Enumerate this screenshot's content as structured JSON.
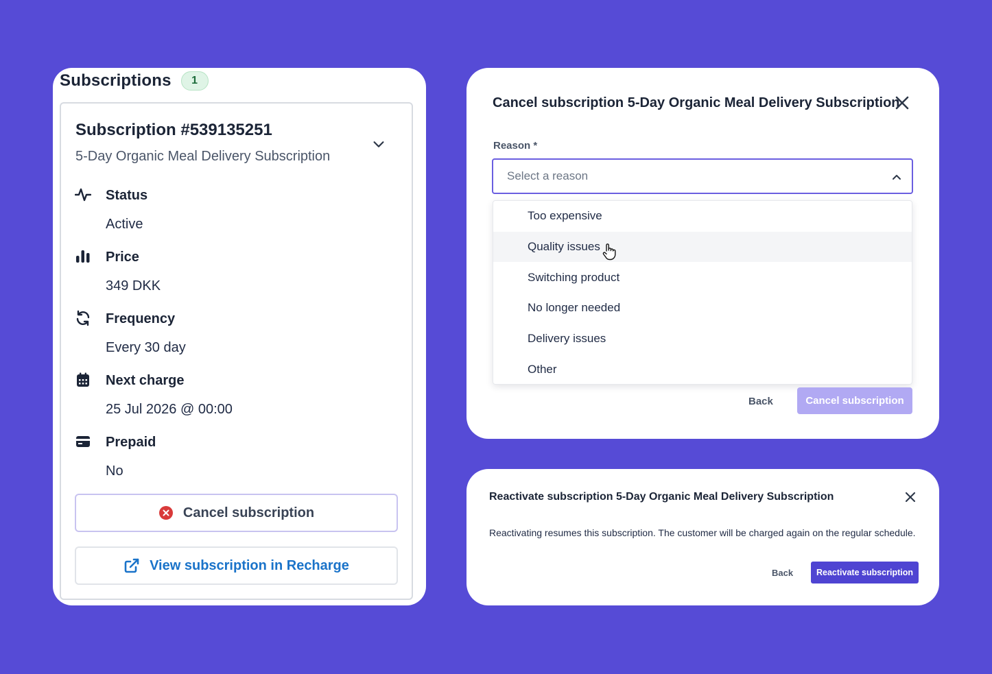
{
  "subscriptions": {
    "title": "Subscriptions",
    "count": "1",
    "card": {
      "id": "Subscription #539135251",
      "product": "5-Day Organic Meal Delivery Subscription",
      "details": [
        {
          "label": "Status",
          "value": "Active",
          "icon": "activity-icon"
        },
        {
          "label": "Price",
          "value": "349 DKK",
          "icon": "bar-chart-icon"
        },
        {
          "label": "Frequency",
          "value": "Every 30 day",
          "icon": "refresh-icon"
        },
        {
          "label": "Next charge",
          "value": "25 Jul 2026 @ 00:00",
          "icon": "calendar-icon"
        },
        {
          "label": "Prepaid",
          "value": "No",
          "icon": "credit-card-icon"
        }
      ],
      "cancel_label": "Cancel subscription",
      "view_label": "View subscription in Recharge"
    }
  },
  "cancel_modal": {
    "title": "Cancel subscription 5-Day Organic Meal Delivery Subscription",
    "reason_label": "Reason *",
    "select_placeholder": "Select a reason",
    "options": [
      "Too expensive",
      "Quality issues",
      "Switching product",
      "No longer needed",
      "Delivery issues",
      "Other"
    ],
    "hovered_option": "Quality issues",
    "back_label": "Back",
    "submit_label": "Cancel subscription"
  },
  "reactivate_modal": {
    "title": "Reactivate subscription 5-Day Organic Meal Delivery Subscription",
    "message": "Reactivating resumes this subscription. The customer will be charged again on the regular schedule.",
    "back_label": "Back",
    "submit_label": "Reactivate subscription"
  },
  "colors": {
    "background": "#564bd6",
    "accent": "#4f44d2",
    "accent_disabled": "#b1a9f3",
    "link": "#1a73c9",
    "danger": "#d93a3a",
    "badge_bg": "#dff4e6"
  }
}
